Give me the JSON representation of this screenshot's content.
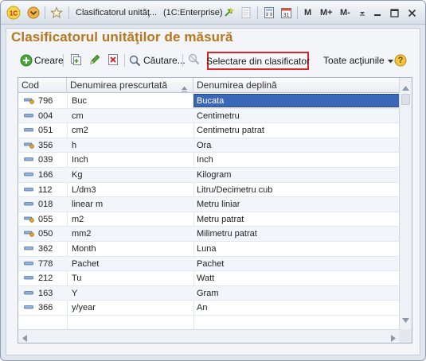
{
  "window": {
    "title": "Clasificatorul unităţ...",
    "app_name": "(1C:Enterprise)",
    "toolbar_buttons": [
      "M",
      "M+",
      "M-"
    ]
  },
  "form": {
    "title": "Clasificatorul unităţilor de măsură"
  },
  "commands": {
    "create": "Creare",
    "search": "Căutare...",
    "select_from_classifier": "Selectare din clasificator",
    "all_actions": "Toate acţiunile",
    "help": "?"
  },
  "table": {
    "columns": [
      "Cod",
      "Denumirea prescurtată",
      "Denumirea deplină"
    ],
    "rows": [
      {
        "code": "796",
        "short": "Buc",
        "full": "Bucata",
        "selected": true,
        "icon": "key-icon"
      },
      {
        "code": "004",
        "short": "cm",
        "full": "Centimetru",
        "icon": "dash-icon"
      },
      {
        "code": "051",
        "short": "cm2",
        "full": "Centimetru patrat",
        "icon": "dash-icon"
      },
      {
        "code": "356",
        "short": "h",
        "full": "Ora",
        "icon": "key-icon"
      },
      {
        "code": "039",
        "short": "Inch",
        "full": "Inch",
        "icon": "dash-icon"
      },
      {
        "code": "166",
        "short": "Kg",
        "full": "Kilogram",
        "icon": "dash-icon"
      },
      {
        "code": "112",
        "short": "L/dm3",
        "full": "Litru/Decimetru cub",
        "icon": "dash-icon"
      },
      {
        "code": "018",
        "short": "linear m",
        "full": "Metru liniar",
        "icon": "dash-icon"
      },
      {
        "code": "055",
        "short": "m2",
        "full": "Metru patrat",
        "icon": "key-icon"
      },
      {
        "code": "050",
        "short": "mm2",
        "full": "Milimetru patrat",
        "icon": "key-icon"
      },
      {
        "code": "362",
        "short": "Month",
        "full": "Luna",
        "icon": "dash-icon"
      },
      {
        "code": "778",
        "short": "Pachet",
        "full": "Pachet",
        "icon": "dash-icon"
      },
      {
        "code": "212",
        "short": "Tu",
        "full": "Watt",
        "icon": "dash-icon"
      },
      {
        "code": "163",
        "short": "Y",
        "full": "Gram",
        "icon": "dash-icon"
      },
      {
        "code": "366",
        "short": "y/year",
        "full": "An",
        "icon": "dash-icon"
      }
    ]
  },
  "colors": {
    "title": "#b8761c",
    "selection": "#3b67b8",
    "highlight_border": "#d9262b"
  }
}
